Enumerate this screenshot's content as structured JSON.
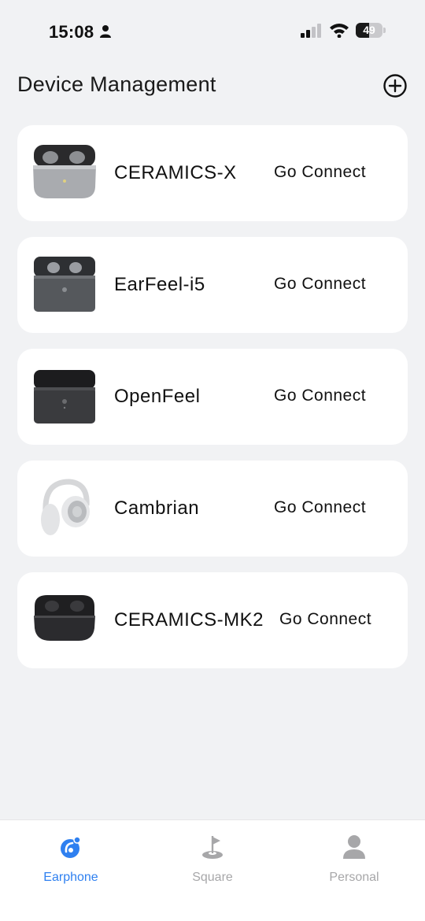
{
  "status_bar": {
    "time": "15:08",
    "battery_level": 49,
    "battery_text": "49"
  },
  "header": {
    "title": "Device Management",
    "add_icon": "plus-circle-icon"
  },
  "devices": [
    {
      "name": "CERAMICS-X",
      "action": "Go Connect",
      "image": "earbuds-case-silver"
    },
    {
      "name": "EarFeel-i5",
      "action": "Go Connect",
      "image": "earbuds-case-gunmetal"
    },
    {
      "name": "OpenFeel",
      "action": "Go Connect",
      "image": "earbuds-case-black"
    },
    {
      "name": "Cambrian",
      "action": "Go Connect",
      "image": "headphones-white"
    },
    {
      "name": "CERAMICS-MK2",
      "action": "Go Connect",
      "image": "earbuds-case-dark-round"
    }
  ],
  "tabs": [
    {
      "label": "Earphone",
      "icon": "earphone-icon",
      "active": true
    },
    {
      "label": "Square",
      "icon": "flag-icon",
      "active": false
    },
    {
      "label": "Personal",
      "icon": "person-icon",
      "active": false
    }
  ],
  "colors": {
    "accent": "#2f80f0",
    "background": "#f1f2f4",
    "inactive_tab": "#a7a7a9"
  }
}
